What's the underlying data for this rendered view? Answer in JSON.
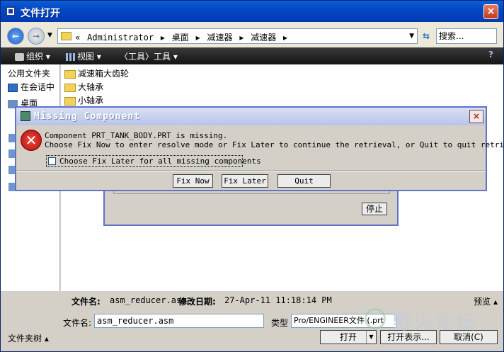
{
  "window": {
    "title": "文件打开",
    "close_label": "×"
  },
  "address": {
    "breadcrumbs": [
      "«",
      "Administrator",
      "▸",
      "桌面",
      "▸",
      "减速器",
      "▸",
      "减速器",
      "▸"
    ],
    "search_placeholder": "搜索..."
  },
  "toolbar": {
    "organize": "组织 ▾",
    "view": "视图 ▾",
    "tools": "〈工具〉工具 ▾"
  },
  "left_pane": {
    "header": "公用文件夹",
    "items": [
      {
        "label": "在会话中"
      },
      {
        "label": "桌面"
      }
    ]
  },
  "file_list": [
    "减速箱大齿轮",
    "大轴承",
    "小轴承"
  ],
  "progress_dialog": {
    "stop_label": "停止"
  },
  "details": {
    "name_label": "文件名:",
    "name_value": "asm_reducer.asm",
    "date_label": "修改日期:",
    "date_value": "27-Apr-11 11:18:14 PM",
    "preview_label": "预览 ▴"
  },
  "filename_field": {
    "label": "文件名:",
    "value": "asm_reducer.asm"
  },
  "type_field": {
    "label": "类型",
    "value": "Pro/ENGINEER文件 (.prt"
  },
  "bottom": {
    "folder_tree": "文件夹树 ▴",
    "open_label": "打开",
    "open_show_label": "打开表示...",
    "cancel_label": "取消(C)"
  },
  "watermark": {
    "text": "野火论坛"
  },
  "missing_dialog": {
    "title": "Missing Component",
    "message_line1": "Component PRT_TANK_BODY.PRT is missing.",
    "message_line2": "Choose Fix Now to enter resolve mode or Fix Later to continue the retrieval, or Quit to quit retrieval.",
    "checkbox_label": "Choose Fix Later for all missing components",
    "fix_now": "Fix Now",
    "fix_later": "Fix Later",
    "quit": "Quit",
    "close_label": "×"
  }
}
